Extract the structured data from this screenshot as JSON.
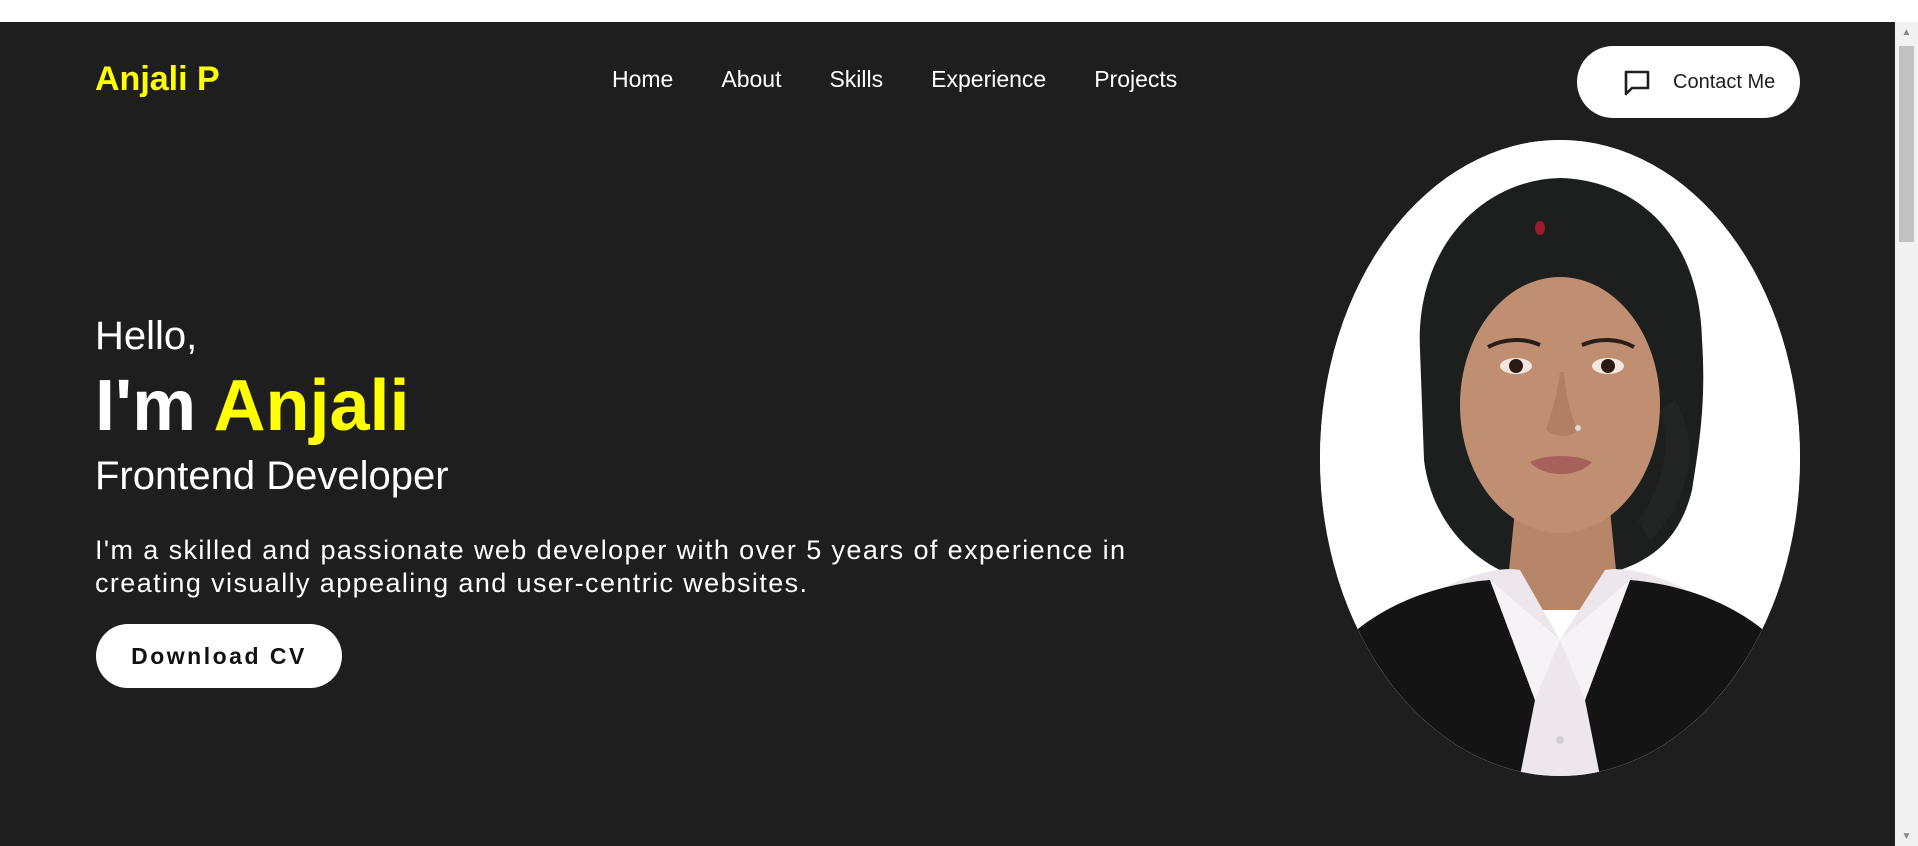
{
  "brand": {
    "name": "Anjali P",
    "accent_color": "#ffff00",
    "background_color": "#1e1e1e"
  },
  "nav": {
    "items": [
      {
        "label": "Home"
      },
      {
        "label": "About"
      },
      {
        "label": "Skills"
      },
      {
        "label": "Experience"
      },
      {
        "label": "Projects"
      }
    ],
    "contact": {
      "label": "Contact Me",
      "icon": "message-square-icon"
    }
  },
  "hero": {
    "greeting": "Hello,",
    "intro_prefix": "I'm",
    "intro_name": "Anjali",
    "role": "Frontend Developer",
    "description": "I'm a skilled and passionate web developer with over 5 years of experience in creating visually appealing and user-centric websites.",
    "cta": "Download CV",
    "photo": "portrait-photo"
  }
}
